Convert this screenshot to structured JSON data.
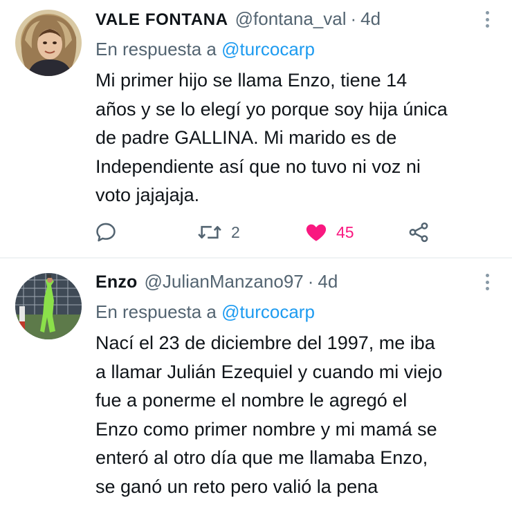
{
  "tweets": [
    {
      "display_name": "VALE FONTANA",
      "handle": "@fontana_val",
      "separator": "·",
      "time": "4d",
      "reply_prefix": "En respuesta a",
      "reply_to": "@turcocarp",
      "text": "Mi primer hijo se llama Enzo, tiene 14\naños y se lo elegí yo porque soy hija única\nde padre GALLINA. Mi marido es de\nIndependiente así que no tuvo ni voz ni\nvoto jajajaja.",
      "retweets": "2",
      "likes": "45",
      "liked": true
    },
    {
      "display_name": "Enzo",
      "handle": "@JulianManzano97",
      "separator": "·",
      "time": "4d",
      "reply_prefix": "En respuesta a",
      "reply_to": "@turcocarp",
      "text": "Nací el 23 de diciembre del 1997, me iba\na llamar Julián Ezequiel y cuando mi viejo\nfue a ponerme el nombre le agregó el\nEnzo como primer nombre y mi mamá se\nenteró al otro día que me llamaba Enzo,\nse ganó un reto pero valió la pena"
    }
  ],
  "icons": {
    "reply": "reply-icon",
    "retweet": "retweet-icon",
    "like": "heart-icon",
    "share": "share-icon",
    "more": "more-options-icon"
  },
  "colors": {
    "text": "#0f1419",
    "secondary": "#536471",
    "link": "#1d9bf0",
    "like": "#f91880",
    "divider": "#eff3f4"
  }
}
